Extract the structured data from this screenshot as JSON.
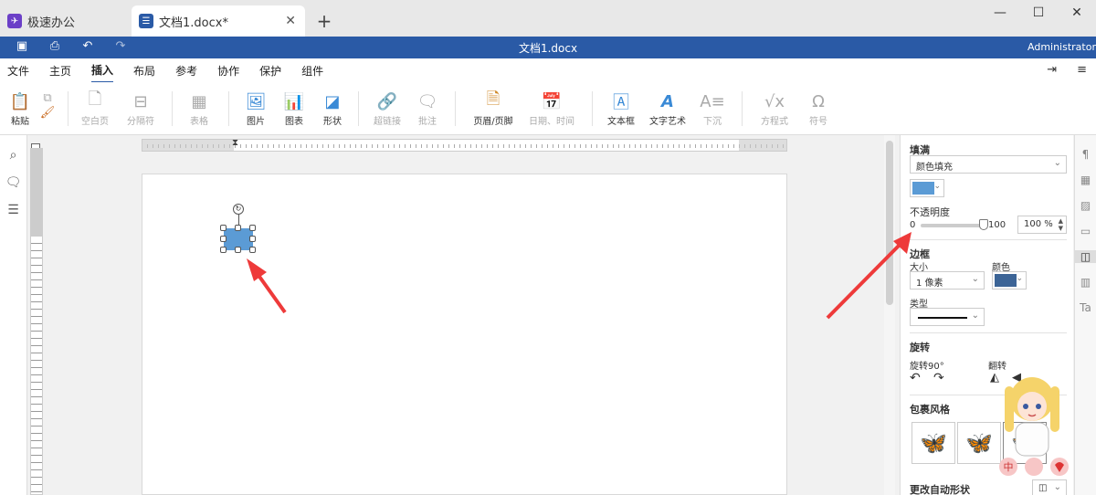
{
  "tabs": [
    {
      "label": "极速办公",
      "icon": "app-logo-icon",
      "color": "#6b3fc7"
    },
    {
      "label": "文档1.docx*",
      "icon": "document-icon",
      "color": "#2a5aa6"
    }
  ],
  "window": {
    "title": "文档1.docx",
    "user": "Administrator"
  },
  "menu": [
    "文件",
    "主页",
    "插入",
    "布局",
    "参考",
    "协作",
    "保护",
    "组件"
  ],
  "active_menu": "插入",
  "ribbon": {
    "paste": "粘贴",
    "blank_page": "空白页",
    "page_break": "分隔符",
    "table": "表格",
    "image": "图片",
    "chart": "图表",
    "shape": "形状",
    "hyperlink": "超链接",
    "comment": "批注",
    "header_footer": "页眉/页脚",
    "date_time": "日期、时间",
    "text_box": "文本框",
    "text_art": "文字艺术",
    "drop_cap": "下沉",
    "equation": "方程式",
    "symbol": "符号"
  },
  "panel": {
    "fill_label": "填满",
    "fill_type": "颜色填充",
    "fill_color": "#5b9bd5",
    "opacity_label": "不透明度",
    "opacity_min": "0",
    "opacity_max": "100",
    "opacity_value": "100 %",
    "opacity_fraction": 1.0,
    "border_label": "边框",
    "size_label": "大小",
    "size_value": "1 像素",
    "color_label": "颜色",
    "border_color": "#3c6496",
    "type_label": "类型",
    "rotate_label": "旋转",
    "rotate90_label": "旋转90°",
    "flip_label": "翻转",
    "wrap_label": "包裹风格",
    "autoshape_label": "更改自动形状"
  },
  "shape_color": "#5b9bd5",
  "annotation_color": "#ee3a3a"
}
